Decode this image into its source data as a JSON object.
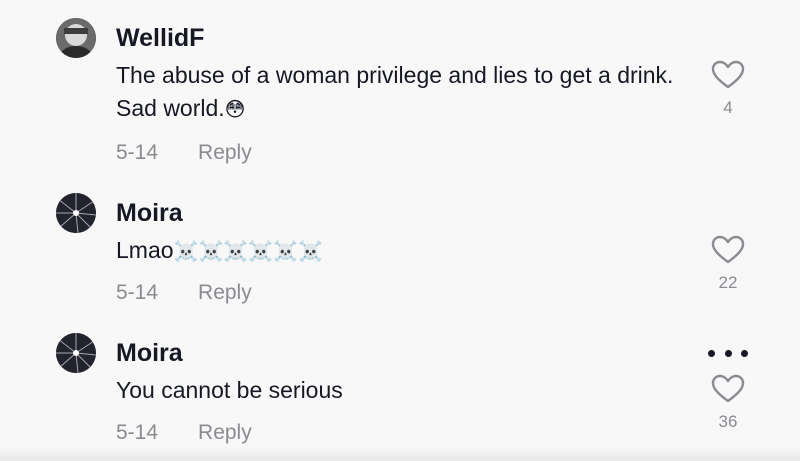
{
  "comments": [
    {
      "username": "WellidF",
      "text": "The abuse of a woman privilege and lies to get a drink. Sad world.",
      "emoji": "😳",
      "date": "5-14",
      "reply_label": "Reply",
      "likes": "4"
    },
    {
      "username": "Moira",
      "text": "Lmao",
      "emoji": "☠️☠️☠️☠️☠️☠️",
      "date": "5-14",
      "reply_label": "Reply",
      "likes": "22"
    },
    {
      "username": "Moira",
      "text": "You cannot be serious",
      "emoji": "",
      "date": "5-14",
      "reply_label": "Reply",
      "likes": "36"
    }
  ],
  "icons": {
    "like": "heart-outline-icon",
    "more": "more-options-icon"
  },
  "colors": {
    "background": "#f8f8f8",
    "text": "#161823",
    "secondary": "#8a8b91"
  }
}
